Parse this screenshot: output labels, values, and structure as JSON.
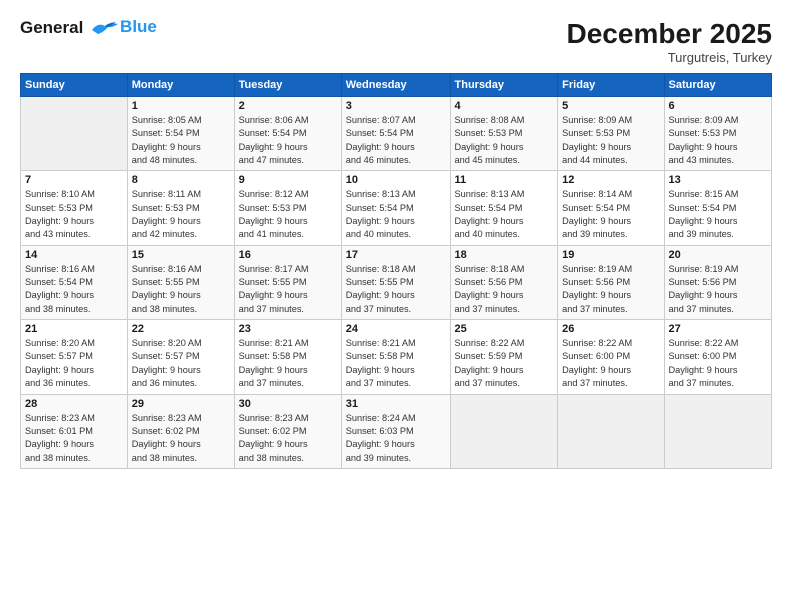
{
  "logo": {
    "line1": "General",
    "line2": "Blue"
  },
  "title": "December 2025",
  "subtitle": "Turgutreis, Turkey",
  "days_header": [
    "Sunday",
    "Monday",
    "Tuesday",
    "Wednesday",
    "Thursday",
    "Friday",
    "Saturday"
  ],
  "weeks": [
    [
      {
        "day": "",
        "info": ""
      },
      {
        "day": "1",
        "info": "Sunrise: 8:05 AM\nSunset: 5:54 PM\nDaylight: 9 hours\nand 48 minutes."
      },
      {
        "day": "2",
        "info": "Sunrise: 8:06 AM\nSunset: 5:54 PM\nDaylight: 9 hours\nand 47 minutes."
      },
      {
        "day": "3",
        "info": "Sunrise: 8:07 AM\nSunset: 5:54 PM\nDaylight: 9 hours\nand 46 minutes."
      },
      {
        "day": "4",
        "info": "Sunrise: 8:08 AM\nSunset: 5:53 PM\nDaylight: 9 hours\nand 45 minutes."
      },
      {
        "day": "5",
        "info": "Sunrise: 8:09 AM\nSunset: 5:53 PM\nDaylight: 9 hours\nand 44 minutes."
      },
      {
        "day": "6",
        "info": "Sunrise: 8:09 AM\nSunset: 5:53 PM\nDaylight: 9 hours\nand 43 minutes."
      }
    ],
    [
      {
        "day": "7",
        "info": "Sunrise: 8:10 AM\nSunset: 5:53 PM\nDaylight: 9 hours\nand 43 minutes."
      },
      {
        "day": "8",
        "info": "Sunrise: 8:11 AM\nSunset: 5:53 PM\nDaylight: 9 hours\nand 42 minutes."
      },
      {
        "day": "9",
        "info": "Sunrise: 8:12 AM\nSunset: 5:53 PM\nDaylight: 9 hours\nand 41 minutes."
      },
      {
        "day": "10",
        "info": "Sunrise: 8:13 AM\nSunset: 5:54 PM\nDaylight: 9 hours\nand 40 minutes."
      },
      {
        "day": "11",
        "info": "Sunrise: 8:13 AM\nSunset: 5:54 PM\nDaylight: 9 hours\nand 40 minutes."
      },
      {
        "day": "12",
        "info": "Sunrise: 8:14 AM\nSunset: 5:54 PM\nDaylight: 9 hours\nand 39 minutes."
      },
      {
        "day": "13",
        "info": "Sunrise: 8:15 AM\nSunset: 5:54 PM\nDaylight: 9 hours\nand 39 minutes."
      }
    ],
    [
      {
        "day": "14",
        "info": "Sunrise: 8:16 AM\nSunset: 5:54 PM\nDaylight: 9 hours\nand 38 minutes."
      },
      {
        "day": "15",
        "info": "Sunrise: 8:16 AM\nSunset: 5:55 PM\nDaylight: 9 hours\nand 38 minutes."
      },
      {
        "day": "16",
        "info": "Sunrise: 8:17 AM\nSunset: 5:55 PM\nDaylight: 9 hours\nand 37 minutes."
      },
      {
        "day": "17",
        "info": "Sunrise: 8:18 AM\nSunset: 5:55 PM\nDaylight: 9 hours\nand 37 minutes."
      },
      {
        "day": "18",
        "info": "Sunrise: 8:18 AM\nSunset: 5:56 PM\nDaylight: 9 hours\nand 37 minutes."
      },
      {
        "day": "19",
        "info": "Sunrise: 8:19 AM\nSunset: 5:56 PM\nDaylight: 9 hours\nand 37 minutes."
      },
      {
        "day": "20",
        "info": "Sunrise: 8:19 AM\nSunset: 5:56 PM\nDaylight: 9 hours\nand 37 minutes."
      }
    ],
    [
      {
        "day": "21",
        "info": "Sunrise: 8:20 AM\nSunset: 5:57 PM\nDaylight: 9 hours\nand 36 minutes."
      },
      {
        "day": "22",
        "info": "Sunrise: 8:20 AM\nSunset: 5:57 PM\nDaylight: 9 hours\nand 36 minutes."
      },
      {
        "day": "23",
        "info": "Sunrise: 8:21 AM\nSunset: 5:58 PM\nDaylight: 9 hours\nand 37 minutes."
      },
      {
        "day": "24",
        "info": "Sunrise: 8:21 AM\nSunset: 5:58 PM\nDaylight: 9 hours\nand 37 minutes."
      },
      {
        "day": "25",
        "info": "Sunrise: 8:22 AM\nSunset: 5:59 PM\nDaylight: 9 hours\nand 37 minutes."
      },
      {
        "day": "26",
        "info": "Sunrise: 8:22 AM\nSunset: 6:00 PM\nDaylight: 9 hours\nand 37 minutes."
      },
      {
        "day": "27",
        "info": "Sunrise: 8:22 AM\nSunset: 6:00 PM\nDaylight: 9 hours\nand 37 minutes."
      }
    ],
    [
      {
        "day": "28",
        "info": "Sunrise: 8:23 AM\nSunset: 6:01 PM\nDaylight: 9 hours\nand 38 minutes."
      },
      {
        "day": "29",
        "info": "Sunrise: 8:23 AM\nSunset: 6:02 PM\nDaylight: 9 hours\nand 38 minutes."
      },
      {
        "day": "30",
        "info": "Sunrise: 8:23 AM\nSunset: 6:02 PM\nDaylight: 9 hours\nand 38 minutes."
      },
      {
        "day": "31",
        "info": "Sunrise: 8:24 AM\nSunset: 6:03 PM\nDaylight: 9 hours\nand 39 minutes."
      },
      {
        "day": "",
        "info": ""
      },
      {
        "day": "",
        "info": ""
      },
      {
        "day": "",
        "info": ""
      }
    ]
  ]
}
